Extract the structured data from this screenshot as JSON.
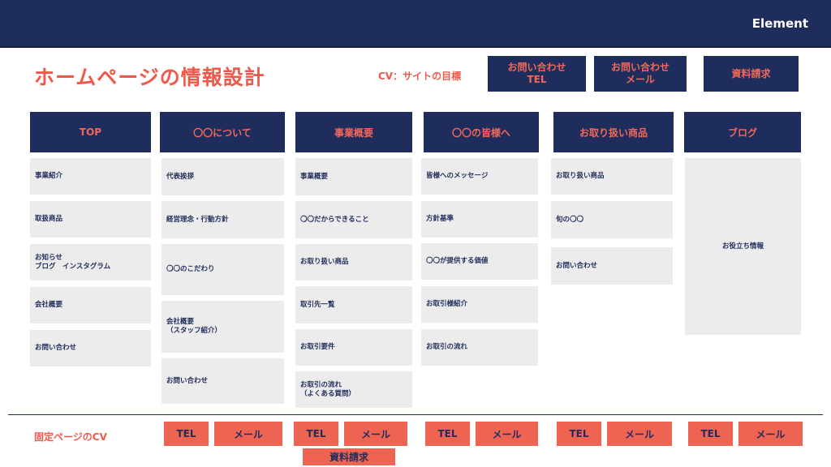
{
  "header": {
    "brand": "Element"
  },
  "title": "ホームページの情報設計",
  "cv": {
    "label": "CV：サイトの目標",
    "buttons": [
      "お問い合わせ\nTEL",
      "お問い合わせ\nメール",
      "資料請求"
    ]
  },
  "columns": [
    {
      "header": "TOP",
      "items": [
        "事業紹介",
        "取扱商品",
        "お知らせ\nブログ　インスタグラム",
        "会社概要",
        "お問い合わせ"
      ]
    },
    {
      "header": "〇〇について",
      "items": [
        "代表挨拶",
        "経営理念・行動方針",
        "〇〇のこだわり",
        "会社概要\n（スタッフ紹介）",
        "お問い合わせ"
      ]
    },
    {
      "header": "事業概要",
      "items": [
        "事業概要",
        "〇〇だからできること",
        "お取り扱い商品",
        "取引先一覧",
        "お取引要件",
        "お取引の流れ\n（よくある質問）"
      ]
    },
    {
      "header": "〇〇の皆様へ",
      "items": [
        "皆様へのメッセージ",
        "方針基準",
        "〇〇が提供する価値",
        "お取引様紹介",
        "お取引の流れ"
      ]
    },
    {
      "header": "お取り扱い商品",
      "items": [
        "お取り扱い商品",
        "旬の〇〇",
        "お問い合わせ"
      ]
    },
    {
      "header": "ブログ",
      "items": [
        "お役立ち情報"
      ]
    }
  ],
  "fixed_cv": {
    "label": "固定ページのCV",
    "tel": "TEL",
    "mail": "メール",
    "doc": "資料請求"
  }
}
